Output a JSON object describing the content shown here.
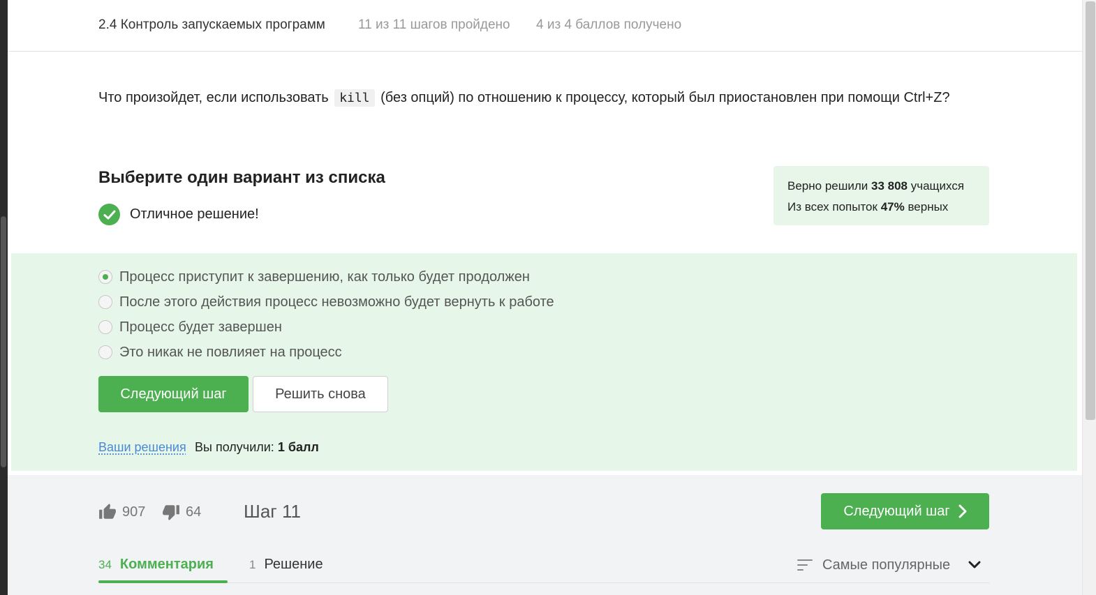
{
  "header": {
    "lesson_title": "2.4 Контроль запускаемых программ",
    "progress": "11 из 11 шагов пройдено",
    "score": "4 из 4 баллов  получено"
  },
  "question": {
    "before": "Что произойдет, если использовать ",
    "code": "kill",
    "after": " (без опций) по отношению к процессу, который был приостановлен при помощи Ctrl+Z?"
  },
  "quiz": {
    "title": "Выберите один вариант из списка",
    "result_text": "Отличное решение!",
    "options": [
      {
        "label": "Процесс приступит к завершению, как только будет продолжен",
        "selected": true
      },
      {
        "label": "После этого действия процесс невозможно будет вернуть к работе",
        "selected": false
      },
      {
        "label": "Процесс будет завершен",
        "selected": false
      },
      {
        "label": "Это никак не повлияет на процесс",
        "selected": false
      }
    ],
    "next_button": "Следующий шаг",
    "retry_button": "Решить снова",
    "your_solutions_link": "Ваши решения",
    "you_got_label": "Вы получили: ",
    "you_got_value": "1 балл"
  },
  "stats": {
    "solved_prefix": "Верно решили ",
    "solved_count": "33 808",
    "solved_suffix": " учащихся",
    "attempts_prefix": "Из всех попыток ",
    "attempts_percent": "47%",
    "attempts_suffix": " верных"
  },
  "footer": {
    "likes": "907",
    "dislikes": "64",
    "step_label": "Шаг 11",
    "next_step_button": "Следующий шаг",
    "tabs": [
      {
        "count": "34",
        "label": "Комментария",
        "active": true
      },
      {
        "count": "1",
        "label": "Решение",
        "active": false
      }
    ],
    "sort_label": "Самые популярные"
  },
  "colors": {
    "accent_green": "#4caf50",
    "success_bg": "#e6f6e8",
    "link_blue": "#4a8ad4"
  },
  "icons": [
    "check-icon",
    "thumbs-up-icon",
    "thumbs-down-icon",
    "chevron-right-icon",
    "sort-icon",
    "chevron-down-icon"
  ]
}
